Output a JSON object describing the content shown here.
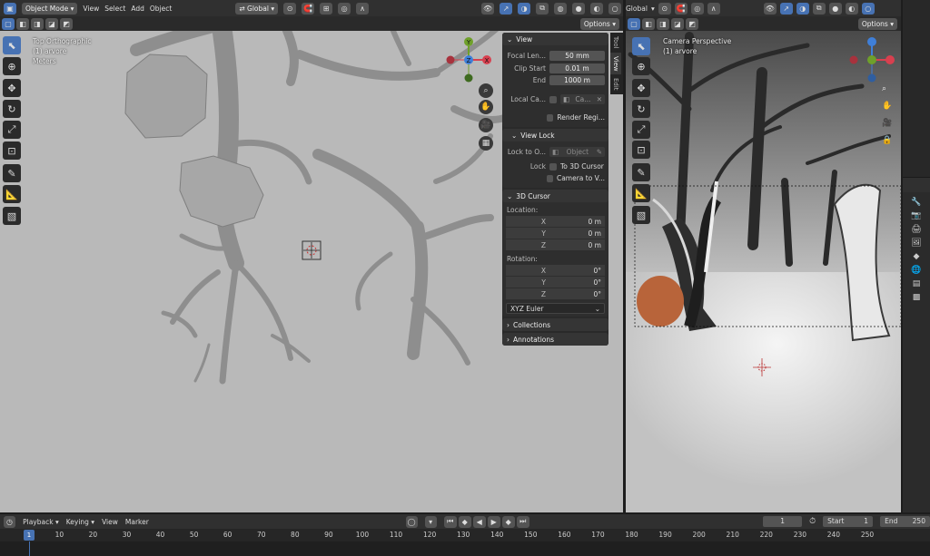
{
  "left_viewport": {
    "header": {
      "mode": "Object Mode",
      "menus": [
        "View",
        "Select",
        "Add",
        "Object"
      ],
      "orientation": "Global",
      "options_label": "Options"
    },
    "overlay": {
      "view_name": "Top Orthographic",
      "collection": "(1) arvore",
      "units": "Meters"
    },
    "gizmo": {
      "y": "Y",
      "x": "X",
      "z": "Z"
    }
  },
  "sidebar": {
    "tabs": [
      "Tool",
      "View",
      "Edit"
    ],
    "active_tab": "View",
    "view_section": {
      "title": "View",
      "focal_length_label": "Focal Len...",
      "focal_length_value": "50 mm",
      "clip_start_label": "Clip Start",
      "clip_start_value": "0.01 m",
      "clip_end_label": "End",
      "clip_end_value": "1000 m",
      "local_camera_label": "Local Ca...",
      "local_camera_value": "Ca...",
      "render_region_label": "Render Regi..."
    },
    "view_lock": {
      "title": "View Lock",
      "lock_to_object_label": "Lock to O...",
      "lock_to_object_placeholder": "Object",
      "lock_label": "Lock",
      "to_3d_cursor_label": "To 3D Cursor",
      "camera_to_view_label": "Camera to V..."
    },
    "cursor_3d": {
      "title": "3D Cursor",
      "location_label": "Location:",
      "location": [
        {
          "axis": "X",
          "value": "0 m"
        },
        {
          "axis": "Y",
          "value": "0 m"
        },
        {
          "axis": "Z",
          "value": "0 m"
        }
      ],
      "rotation_label": "Rotation:",
      "rotation": [
        {
          "axis": "X",
          "value": "0°"
        },
        {
          "axis": "Y",
          "value": "0°"
        },
        {
          "axis": "Z",
          "value": "0°"
        }
      ],
      "rotation_mode": "XYZ Euler"
    },
    "collections_label": "Collections",
    "annotations_label": "Annotations"
  },
  "right_viewport": {
    "header": {
      "orientation": "Global",
      "options_label": "Options"
    },
    "overlay": {
      "view_name": "Camera Perspective",
      "collection": "(1) arvore"
    }
  },
  "timeline": {
    "header": {
      "playback_label": "Playback",
      "keying_label": "Keying",
      "view_label": "View",
      "marker_label": "Marker",
      "current_frame": "1",
      "start_label": "Start",
      "start_value": "1",
      "end_label": "End",
      "end_value": "250"
    },
    "ruler": {
      "current": "1",
      "ticks": [
        "10",
        "20",
        "30",
        "40",
        "50",
        "60",
        "70",
        "80",
        "90",
        "100",
        "110",
        "120",
        "130",
        "140",
        "150",
        "160",
        "170",
        "180",
        "190",
        "200",
        "210",
        "220",
        "230",
        "240",
        "250"
      ]
    }
  },
  "colors": {
    "accent": "#4772b3",
    "header": "#303030",
    "viewport_bg": "#b9b9b9",
    "panel": "#2a2a2a",
    "axis_x": "#d8404f",
    "axis_y": "#6fa02a",
    "axis_z": "#3f7fd8"
  }
}
